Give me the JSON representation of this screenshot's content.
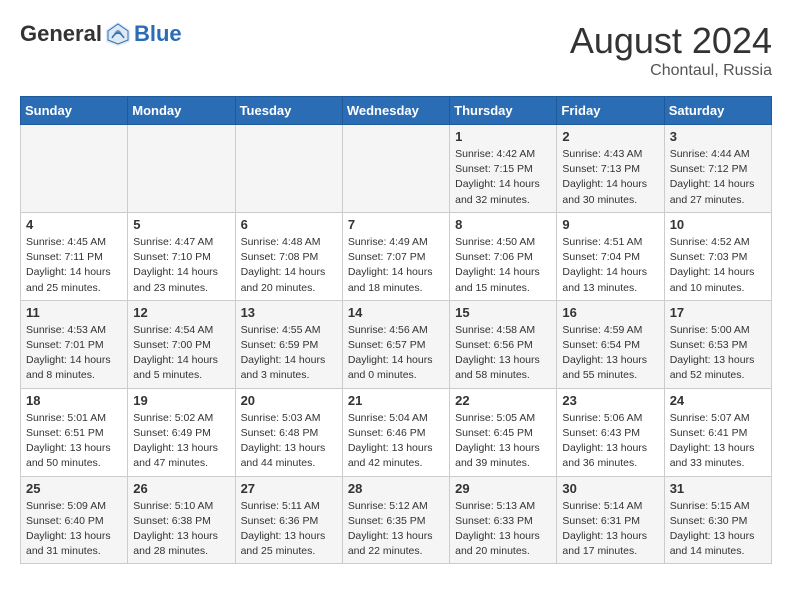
{
  "header": {
    "logo_general": "General",
    "logo_blue": "Blue",
    "month_year": "August 2024",
    "location": "Chontaul, Russia"
  },
  "weekdays": [
    "Sunday",
    "Monday",
    "Tuesday",
    "Wednesday",
    "Thursday",
    "Friday",
    "Saturday"
  ],
  "weeks": [
    [
      {
        "day": "",
        "content": ""
      },
      {
        "day": "",
        "content": ""
      },
      {
        "day": "",
        "content": ""
      },
      {
        "day": "",
        "content": ""
      },
      {
        "day": "1",
        "content": "Sunrise: 4:42 AM\nSunset: 7:15 PM\nDaylight: 14 hours\nand 32 minutes."
      },
      {
        "day": "2",
        "content": "Sunrise: 4:43 AM\nSunset: 7:13 PM\nDaylight: 14 hours\nand 30 minutes."
      },
      {
        "day": "3",
        "content": "Sunrise: 4:44 AM\nSunset: 7:12 PM\nDaylight: 14 hours\nand 27 minutes."
      }
    ],
    [
      {
        "day": "4",
        "content": "Sunrise: 4:45 AM\nSunset: 7:11 PM\nDaylight: 14 hours\nand 25 minutes."
      },
      {
        "day": "5",
        "content": "Sunrise: 4:47 AM\nSunset: 7:10 PM\nDaylight: 14 hours\nand 23 minutes."
      },
      {
        "day": "6",
        "content": "Sunrise: 4:48 AM\nSunset: 7:08 PM\nDaylight: 14 hours\nand 20 minutes."
      },
      {
        "day": "7",
        "content": "Sunrise: 4:49 AM\nSunset: 7:07 PM\nDaylight: 14 hours\nand 18 minutes."
      },
      {
        "day": "8",
        "content": "Sunrise: 4:50 AM\nSunset: 7:06 PM\nDaylight: 14 hours\nand 15 minutes."
      },
      {
        "day": "9",
        "content": "Sunrise: 4:51 AM\nSunset: 7:04 PM\nDaylight: 14 hours\nand 13 minutes."
      },
      {
        "day": "10",
        "content": "Sunrise: 4:52 AM\nSunset: 7:03 PM\nDaylight: 14 hours\nand 10 minutes."
      }
    ],
    [
      {
        "day": "11",
        "content": "Sunrise: 4:53 AM\nSunset: 7:01 PM\nDaylight: 14 hours\nand 8 minutes."
      },
      {
        "day": "12",
        "content": "Sunrise: 4:54 AM\nSunset: 7:00 PM\nDaylight: 14 hours\nand 5 minutes."
      },
      {
        "day": "13",
        "content": "Sunrise: 4:55 AM\nSunset: 6:59 PM\nDaylight: 14 hours\nand 3 minutes."
      },
      {
        "day": "14",
        "content": "Sunrise: 4:56 AM\nSunset: 6:57 PM\nDaylight: 14 hours\nand 0 minutes."
      },
      {
        "day": "15",
        "content": "Sunrise: 4:58 AM\nSunset: 6:56 PM\nDaylight: 13 hours\nand 58 minutes."
      },
      {
        "day": "16",
        "content": "Sunrise: 4:59 AM\nSunset: 6:54 PM\nDaylight: 13 hours\nand 55 minutes."
      },
      {
        "day": "17",
        "content": "Sunrise: 5:00 AM\nSunset: 6:53 PM\nDaylight: 13 hours\nand 52 minutes."
      }
    ],
    [
      {
        "day": "18",
        "content": "Sunrise: 5:01 AM\nSunset: 6:51 PM\nDaylight: 13 hours\nand 50 minutes."
      },
      {
        "day": "19",
        "content": "Sunrise: 5:02 AM\nSunset: 6:49 PM\nDaylight: 13 hours\nand 47 minutes."
      },
      {
        "day": "20",
        "content": "Sunrise: 5:03 AM\nSunset: 6:48 PM\nDaylight: 13 hours\nand 44 minutes."
      },
      {
        "day": "21",
        "content": "Sunrise: 5:04 AM\nSunset: 6:46 PM\nDaylight: 13 hours\nand 42 minutes."
      },
      {
        "day": "22",
        "content": "Sunrise: 5:05 AM\nSunset: 6:45 PM\nDaylight: 13 hours\nand 39 minutes."
      },
      {
        "day": "23",
        "content": "Sunrise: 5:06 AM\nSunset: 6:43 PM\nDaylight: 13 hours\nand 36 minutes."
      },
      {
        "day": "24",
        "content": "Sunrise: 5:07 AM\nSunset: 6:41 PM\nDaylight: 13 hours\nand 33 minutes."
      }
    ],
    [
      {
        "day": "25",
        "content": "Sunrise: 5:09 AM\nSunset: 6:40 PM\nDaylight: 13 hours\nand 31 minutes."
      },
      {
        "day": "26",
        "content": "Sunrise: 5:10 AM\nSunset: 6:38 PM\nDaylight: 13 hours\nand 28 minutes."
      },
      {
        "day": "27",
        "content": "Sunrise: 5:11 AM\nSunset: 6:36 PM\nDaylight: 13 hours\nand 25 minutes."
      },
      {
        "day": "28",
        "content": "Sunrise: 5:12 AM\nSunset: 6:35 PM\nDaylight: 13 hours\nand 22 minutes."
      },
      {
        "day": "29",
        "content": "Sunrise: 5:13 AM\nSunset: 6:33 PM\nDaylight: 13 hours\nand 20 minutes."
      },
      {
        "day": "30",
        "content": "Sunrise: 5:14 AM\nSunset: 6:31 PM\nDaylight: 13 hours\nand 17 minutes."
      },
      {
        "day": "31",
        "content": "Sunrise: 5:15 AM\nSunset: 6:30 PM\nDaylight: 13 hours\nand 14 minutes."
      }
    ]
  ]
}
